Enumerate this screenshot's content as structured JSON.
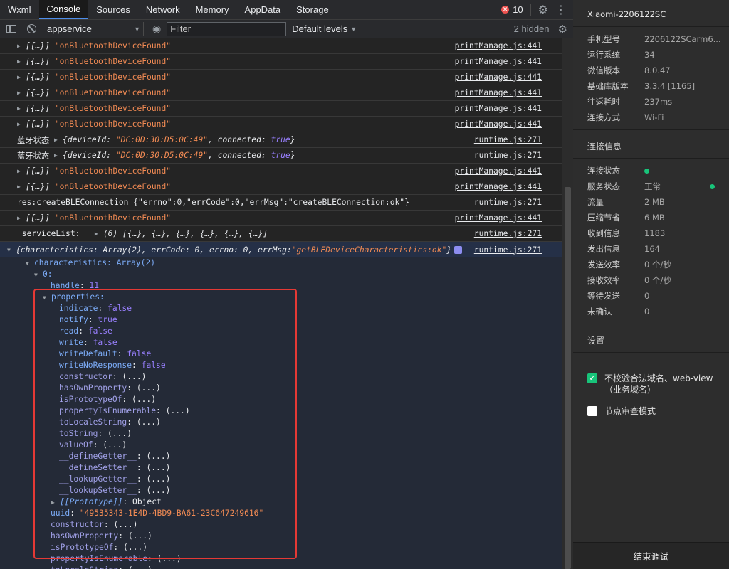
{
  "tabs": [
    "Wxml",
    "Console",
    "Sources",
    "Network",
    "Memory",
    "AppData",
    "Storage"
  ],
  "active_tab": "Console",
  "error_count": "10",
  "toolbar": {
    "context": "appservice",
    "filter_placeholder": "Filter",
    "levels": "Default levels",
    "hidden": "2 hidden"
  },
  "logs": [
    {
      "text": "[{…}]",
      "msg": "\"onBluetoothDeviceFound\"",
      "src": "printManage.js:441"
    },
    {
      "text": "[{…}]",
      "msg": "\"onBluetoothDeviceFound\"",
      "src": "printManage.js:441"
    },
    {
      "text": "[{…}]",
      "msg": "\"onBluetoothDeviceFound\"",
      "src": "printManage.js:441"
    },
    {
      "text": "[{…}]",
      "msg": "\"onBluetoothDeviceFound\"",
      "src": "printManage.js:441"
    },
    {
      "text": "[{…}]",
      "msg": "\"onBluetoothDeviceFound\"",
      "src": "printManage.js:441"
    },
    {
      "text": "[{…}]",
      "msg": "\"onBluetoothDeviceFound\"",
      "src": "printManage.js:441"
    },
    {
      "label": "蓝牙状态",
      "deviceId_key": "deviceId",
      "deviceId": "\"DC:0D:30:D5:0C:49\"",
      "connected_key": "connected",
      "connected": "true",
      "src": "runtime.js:271"
    },
    {
      "label": "蓝牙状态",
      "deviceId_key": "deviceId",
      "deviceId": "\"DC:0D:30:D5:0C:49\"",
      "connected_key": "connected",
      "connected": "true",
      "src": "runtime.js:271"
    },
    {
      "text": "[{…}]",
      "msg": "\"onBluetoothDeviceFound\"",
      "src": "printManage.js:441"
    },
    {
      "text": "[{…}]",
      "msg": "\"onBluetoothDeviceFound\"",
      "src": "printManage.js:441"
    },
    {
      "plain": "res:createBLEConnection {\"errno\":0,\"errCode\":0,\"errMsg\":\"createBLEConnection:ok\"}",
      "src": "runtime.js:271"
    },
    {
      "text": "[{…}]",
      "msg": "\"onBluetoothDeviceFound\"",
      "src": "printManage.js:441"
    },
    {
      "label": "_serviceList:",
      "arr": "(6) [{…}, {…}, {…}, {…}, {…}, {…}]",
      "src": "runtime.js:271"
    }
  ],
  "expanded": {
    "summary_prefix": "{characteristics: Array(2), errCode: 0, errno: 0, errMsg: ",
    "summary_str": "\"getBLEDeviceCharacteristics:ok\"",
    "summary_suffix": "}",
    "src": "runtime.js:271",
    "characteristics_line": "characteristics: Array(2)",
    "index0": "0:",
    "handle_key": "handle",
    "handle_val": "11",
    "properties_key": "properties:",
    "props": [
      {
        "k": "indicate",
        "v": "false"
      },
      {
        "k": "notify",
        "v": "true"
      },
      {
        "k": "read",
        "v": "false"
      },
      {
        "k": "write",
        "v": "false"
      },
      {
        "k": "writeDefault",
        "v": "false"
      },
      {
        "k": "writeNoResponse",
        "v": "false"
      }
    ],
    "proto_methods": [
      "constructor",
      "hasOwnProperty",
      "isPrototypeOf",
      "propertyIsEnumerable",
      "toLocaleString",
      "toString",
      "valueOf",
      "__defineGetter__",
      "__defineSetter__",
      "__lookupGetter__",
      "__lookupSetter__"
    ],
    "proto_placeholder": "(...)",
    "prototype_key": "[[Prototype]]",
    "prototype_val": "Object",
    "uuid_key": "uuid",
    "uuid_val": "\"49535343-1E4D-4BD9-BA61-23C647249616\"",
    "outer_methods": [
      "constructor",
      "hasOwnProperty",
      "isPrototypeOf",
      "propertyIsEnumerable",
      "toLocaleString"
    ]
  },
  "panel": {
    "device": "Xiaomi-2206122SC",
    "info": [
      {
        "k": "手机型号",
        "v": "2206122SCarm6..."
      },
      {
        "k": "运行系统",
        "v": "34"
      },
      {
        "k": "微信版本",
        "v": "8.0.47"
      },
      {
        "k": "基础库版本",
        "v": "3.3.4 [1165]"
      },
      {
        "k": "往返耗时",
        "v": "237ms"
      },
      {
        "k": "连接方式",
        "v": "Wi-Fi"
      }
    ],
    "conn_title": "连接信息",
    "conn": [
      {
        "k": "连接状态",
        "v": ""
      },
      {
        "k": "服务状态",
        "v": "正常"
      },
      {
        "k": "流量",
        "v": "2 MB"
      },
      {
        "k": "压缩节省",
        "v": "6 MB"
      },
      {
        "k": "收到信息",
        "v": "1183"
      },
      {
        "k": "发出信息",
        "v": "164"
      },
      {
        "k": "发送效率",
        "v": "0 个/秒"
      },
      {
        "k": "接收效率",
        "v": "0 个/秒"
      },
      {
        "k": "等待发送",
        "v": "0"
      },
      {
        "k": "未确认",
        "v": "0"
      }
    ],
    "settings_title": "设置",
    "opt1": "不校验合法域名、web-view（业务域名）",
    "opt2": "节点审查模式",
    "end_button": "结束调试"
  }
}
